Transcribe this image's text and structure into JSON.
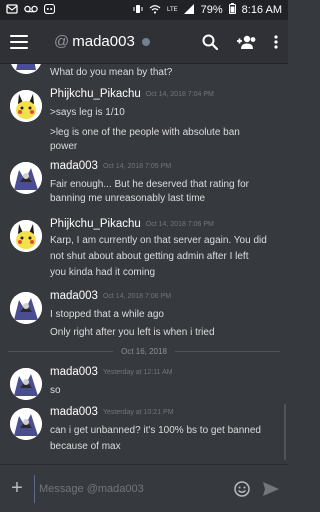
{
  "status_bar": {
    "battery": "79%",
    "time": "8:16 AM",
    "network": "LTE"
  },
  "header": {
    "at": "@",
    "channel": "mada003"
  },
  "messages": [
    {
      "author": "",
      "time": "",
      "lines": [
        "What do you mean by that?"
      ]
    },
    {
      "author": "Phijkchu_Pikachu",
      "time": "Oct 14, 2018 7:04 PM",
      "lines": [
        ">says leg is 1/10",
        ">leg is one of the people with absolute ban",
        "power"
      ]
    },
    {
      "author": "mada003",
      "time": "Oct 14, 2018 7:05 PM",
      "lines": [
        "Fair enough... But he deserved that rating for",
        "banning me unreasonably last  time"
      ]
    },
    {
      "author": "Phijkchu_Pikachu",
      "time": "Oct 14, 2018 7:06 PM",
      "lines": [
        "Karp, I am currently on that server again. You did",
        "not shut about about getting admin after I left",
        "you kinda had it coming"
      ]
    },
    {
      "author": "mada003",
      "time": "Oct 14, 2018 7:06 PM",
      "lines": [
        "I stopped that a while ago",
        "Only right after you left is when i tried"
      ]
    },
    {
      "author": "mada003",
      "time": "Yesterday at 12:11 AM",
      "lines": [
        "so"
      ]
    },
    {
      "author": "mada003",
      "time": "Yesterday at 10:21 PM",
      "lines": [
        "can i get unbanned? it's 100% bs to get banned",
        "because of max"
      ]
    }
  ],
  "divider": "Oct 16, 2018",
  "composer": {
    "placeholder": "Message @mada003"
  },
  "icons": {
    "menu": "menu-icon",
    "search": "search-icon",
    "add_friend": "add-friend-icon",
    "more": "more-vertical-icon",
    "add": "plus-icon",
    "emoji": "emoji-icon",
    "send": "send-icon"
  },
  "colors": {
    "background": "#36393e",
    "header": "#2f3136",
    "status_offline": "#747f8d",
    "text": "#dcddde",
    "muted": "#72767d"
  }
}
